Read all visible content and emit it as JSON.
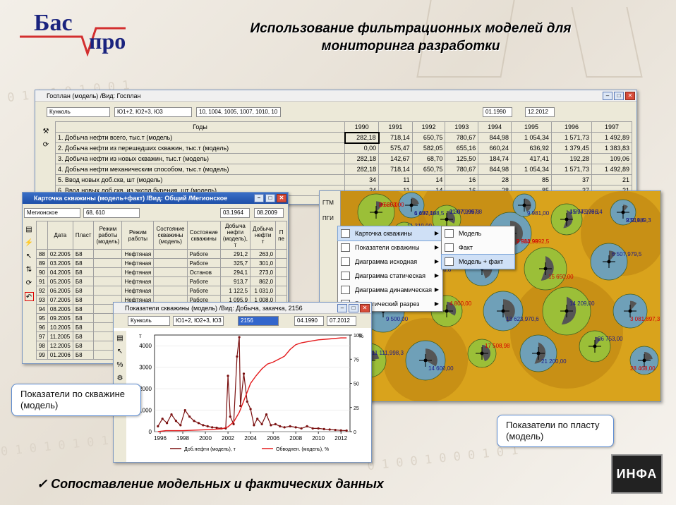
{
  "logo": {
    "line1": "Бас",
    "line2": "про"
  },
  "slide_title": "Использование фильтрационных моделей для мониторинга разработки",
  "main_window": {
    "title": "Госплан (модель) /Вид: Госплан",
    "field": "Кунколь",
    "layers": "Ю1+2, Ю2+3, Ю3",
    "wells": "10, 1004, 1005, 1007, 1010, 10",
    "date_from": "01.1990",
    "date_to": "12.2012",
    "col_header": "Годы",
    "years": [
      "1990",
      "1991",
      "1992",
      "1993",
      "1994",
      "1995",
      "1996",
      "1997"
    ],
    "rows": [
      {
        "label": "1. Добыча нефти всего, тыс.т (модель)",
        "values": [
          "282,18",
          "718,14",
          "650,75",
          "780,67",
          "844,98",
          "1 054,34",
          "1 571,73",
          "1 492,89"
        ]
      },
      {
        "label": "2. Добыча нефти из перешедших скважин, тыс.т (модель)",
        "values": [
          "0,00",
          "575,47",
          "582,05",
          "655,16",
          "660,24",
          "636,92",
          "1 379,45",
          "1 383,83"
        ]
      },
      {
        "label": "3. Добыча нефти из новых скважин, тыс.т (модель)",
        "values": [
          "282,18",
          "142,67",
          "68,70",
          "125,50",
          "184,74",
          "417,41",
          "192,28",
          "109,06"
        ]
      },
      {
        "label": "4. Добыча нефти механическим способом, тыс.т (модель)",
        "values": [
          "282,18",
          "718,14",
          "650,75",
          "780,67",
          "844,98",
          "1 054,34",
          "1 571,73",
          "1 492,89"
        ]
      },
      {
        "label": "5. Ввод новых доб.скв, шт (модель)",
        "values": [
          "34",
          "11",
          "14",
          "16",
          "28",
          "85",
          "37",
          "21"
        ]
      },
      {
        "label": "6. Ввод новых доб.скв. из экспл.бурения, шт (модель)",
        "values": [
          "34",
          "11",
          "14",
          "16",
          "28",
          "85",
          "37",
          "21"
        ]
      }
    ]
  },
  "card_window": {
    "title": "Карточка скважины (модель+факт) /Вид: Общий /Мегионское",
    "field": "Мегионское",
    "wells": "68, 610",
    "date_from": "03.1964",
    "date_to": "08.2009",
    "headers": [
      "",
      "Дата",
      "Пласт",
      "Режим работы (модель)",
      "Режим работы",
      "Состояние скважины (модель)",
      "Состояние скважины",
      "Добыча нефти (модель), т",
      "Добыча нефти т",
      "П пе"
    ],
    "rows": [
      [
        "88",
        "02.2005",
        "Б8",
        "",
        "Нефтяная",
        "",
        "Работе",
        "291,2",
        "263,0"
      ],
      [
        "89",
        "03.2005",
        "Б8",
        "",
        "Нефтяная",
        "",
        "Работе",
        "325,7",
        "301,0"
      ],
      [
        "90",
        "04.2005",
        "Б8",
        "",
        "Нефтяная",
        "",
        "Останов",
        "294,1",
        "273,0"
      ],
      [
        "91",
        "05.2005",
        "Б8",
        "",
        "Нефтяная",
        "",
        "Работе",
        "913,7",
        "862,0"
      ],
      [
        "92",
        "06.2005",
        "Б8",
        "",
        "Нефтяная",
        "",
        "Работе",
        "1 122,5",
        "1 031,0"
      ],
      [
        "93",
        "07.2005",
        "Б8",
        "",
        "Нефтяная",
        "",
        "Работе",
        "1 095,9",
        "1 008,0"
      ],
      [
        "94",
        "08.2005",
        "Б8",
        "",
        "",
        "",
        "",
        "",
        ""
      ],
      [
        "95",
        "09.2005",
        "Б8",
        "",
        "",
        "",
        "",
        "",
        ""
      ],
      [
        "96",
        "10.2005",
        "Б8",
        "",
        "",
        "",
        "",
        "",
        ""
      ],
      [
        "97",
        "11.2005",
        "Б8",
        "",
        "",
        "",
        "",
        "",
        ""
      ],
      [
        "98",
        "12.2005",
        "Б8",
        "",
        "",
        "",
        "",
        "",
        ""
      ],
      [
        "99",
        "01.2006",
        "Б8",
        "",
        "",
        "",
        "",
        "",
        ""
      ]
    ]
  },
  "indicators_window": {
    "title": "Показатели скважины (модель) /Вид: Добыча, закачка, 2156",
    "field": "Кунколь",
    "layers": "Ю1+2, Ю2+3, Ю3",
    "well": "2156",
    "date_from": "04.1990",
    "date_to": "07.2012",
    "y_unit": "т",
    "y2_unit": "%"
  },
  "chart_data": {
    "type": "line",
    "title": "",
    "xlabel": "",
    "ylabel": "т",
    "y2label": "%",
    "xlim": [
      1995.5,
      2012.8
    ],
    "ylim": [
      0,
      4500
    ],
    "y2lim": [
      0,
      100
    ],
    "xticks": [
      "1996",
      "1998",
      "2000",
      "2002",
      "2004",
      "2006",
      "2008",
      "2010",
      "2012"
    ],
    "yticks": [
      "0",
      "1000",
      "2000",
      "3000",
      "4000"
    ],
    "y2ticks": [
      "0",
      "25",
      "50",
      "75",
      "100"
    ],
    "legend": "bottom",
    "series": [
      {
        "name": "Доб.нефти (модель), т",
        "color": "#7a1010",
        "axis": "left",
        "points": [
          [
            1995.8,
            250
          ],
          [
            1996.2,
            600
          ],
          [
            1996.6,
            400
          ],
          [
            1997.0,
            800
          ],
          [
            1997.4,
            500
          ],
          [
            1997.8,
            300
          ],
          [
            1998.2,
            1000
          ],
          [
            1998.6,
            700
          ],
          [
            1999.0,
            500
          ],
          [
            1999.4,
            400
          ],
          [
            1999.8,
            300
          ],
          [
            2000.2,
            250
          ],
          [
            2000.6,
            200
          ],
          [
            2001.0,
            180
          ],
          [
            2001.4,
            150
          ],
          [
            2001.8,
            150
          ],
          [
            2002.0,
            2600
          ],
          [
            2002.2,
            700
          ],
          [
            2002.5,
            350
          ],
          [
            2002.8,
            3500
          ],
          [
            2003.0,
            4400
          ],
          [
            2003.1,
            1200
          ],
          [
            2003.4,
            2700
          ],
          [
            2003.7,
            1400
          ],
          [
            2004.0,
            1050
          ],
          [
            2004.3,
            300
          ],
          [
            2004.6,
            600
          ],
          [
            2005.0,
            350
          ],
          [
            2005.4,
            800
          ],
          [
            2005.8,
            300
          ],
          [
            2006.2,
            350
          ],
          [
            2006.6,
            250
          ],
          [
            2007.0,
            200
          ],
          [
            2007.5,
            250
          ],
          [
            2008.0,
            200
          ],
          [
            2008.5,
            150
          ],
          [
            2009.0,
            250
          ],
          [
            2009.5,
            150
          ],
          [
            2010.0,
            150
          ],
          [
            2010.5,
            120
          ],
          [
            2011.0,
            100
          ],
          [
            2011.5,
            80
          ],
          [
            2012.0,
            60
          ],
          [
            2012.5,
            50
          ]
        ]
      },
      {
        "name": "Обводнен. (модель), %",
        "color": "#e41a1c",
        "axis": "right",
        "points": [
          [
            1995.8,
            0
          ],
          [
            1996.5,
            1
          ],
          [
            1998,
            1
          ],
          [
            2000,
            2
          ],
          [
            2001.5,
            3
          ],
          [
            2002,
            5
          ],
          [
            2002.5,
            10
          ],
          [
            2003,
            20
          ],
          [
            2003.5,
            35
          ],
          [
            2004,
            50
          ],
          [
            2004.5,
            58
          ],
          [
            2005,
            65
          ],
          [
            2005.5,
            70
          ],
          [
            2006,
            72
          ],
          [
            2006.5,
            75
          ],
          [
            2007,
            78
          ],
          [
            2007.5,
            85
          ],
          [
            2008,
            90
          ],
          [
            2008.5,
            92
          ],
          [
            2009,
            93
          ],
          [
            2010,
            95
          ],
          [
            2011,
            96
          ],
          [
            2012,
            97
          ],
          [
            2012.5,
            97
          ]
        ]
      }
    ]
  },
  "context_menu": {
    "left_labels": [
      "ГТМ",
      "ПГИ"
    ],
    "items": [
      {
        "label": "Карточка скважины",
        "icon": "table-icon"
      },
      {
        "label": "Показатели скважины",
        "icon": "chart-icon"
      },
      {
        "label": "Диаграмма исходная",
        "icon": "diagram-icon"
      },
      {
        "label": "Диаграмма статическая",
        "icon": "diagram-icon"
      },
      {
        "label": "Диаграмма динамическая",
        "icon": "diagram-icon"
      },
      {
        "label": "Геологический разрез",
        "icon": "section-icon"
      }
    ],
    "submenu": [
      {
        "label": "Модель"
      },
      {
        "label": "Факт"
      },
      {
        "label": "Модель + факт"
      }
    ]
  },
  "map": {
    "labels": [
      "8 628,0",
      "6 637,198,5",
      "9 307,996,8",
      "19 513,9992,5",
      "15 745,796,4",
      "9 914,4",
      "24 646,00",
      "8 514,876,8",
      "12 509,00",
      "15 650,00",
      "6 507,979,5",
      "9 500,00",
      "4 800,00",
      "13 623,970,6",
      "14 209,00",
      "3 081,897,3",
      "11 111,998,3",
      "14 600,00",
      "17 508,98",
      "21 200,00",
      "26 753,00",
      "28 468,00",
      "11 319,00",
      "9 981,00",
      "26 653,00",
      "1 490,00",
      "11 070,997,8",
      "17 984,98",
      "4 897,998,1",
      "231,989,3"
    ]
  },
  "callouts": {
    "well": "Показатели по скважине (модель)",
    "formation": "Показатели по пласту (модель)"
  },
  "bottom_text": "Сопоставление модельных и фактических данных",
  "brand": "ИНФА"
}
